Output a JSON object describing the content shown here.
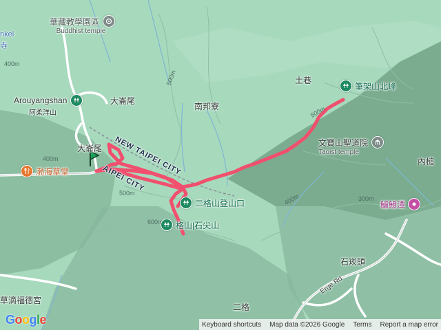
{
  "map": {
    "labels": {
      "buddhist_temple_zh": "華藏教學園區",
      "buddhist_temple_en": "Buddhist temple",
      "arouyangshan_en": "Arouyangshan",
      "arouyangshan_zh": "阿柔洋山",
      "dawuwei_top": "大崙尾",
      "dawuwei_left": "大崙尾",
      "nanbangliao": "南邦寮",
      "tuxiang": "土巷",
      "bijia_north": "筆架山北峰",
      "wenbao_zh": "文寶山聖道院",
      "wenbao_en": "Taoist temple",
      "neiqian": "內槌",
      "tearoom": "渤海草堂",
      "ergeshan_trailhead": "二格山登山口",
      "ergeshan_peak": "格山|石尖山",
      "shiyantou": "石崁頭",
      "eels": "鱸鰻潭",
      "ergerd": "Erge Rd",
      "erge": "二格",
      "fude_temple": "草滴福德宮",
      "left_top_en": "nkel",
      "left_top_zh": "寺"
    },
    "cities": {
      "new_taipei": "NEW TAIPEI CITY",
      "taipei": "AIPEI CITY"
    },
    "contours": [
      "400m",
      "500m",
      "400m",
      "600m",
      "500m",
      "400m",
      "300m",
      "500m"
    ],
    "footer": {
      "shortcuts": "Keyboard shortcuts",
      "mapdata": "Map data ©2026 Google",
      "terms": "Terms",
      "report": "Report a map error"
    },
    "logo": "Google",
    "colors": {
      "track": "#f0506e",
      "start_marker": "#1aa35a"
    }
  }
}
